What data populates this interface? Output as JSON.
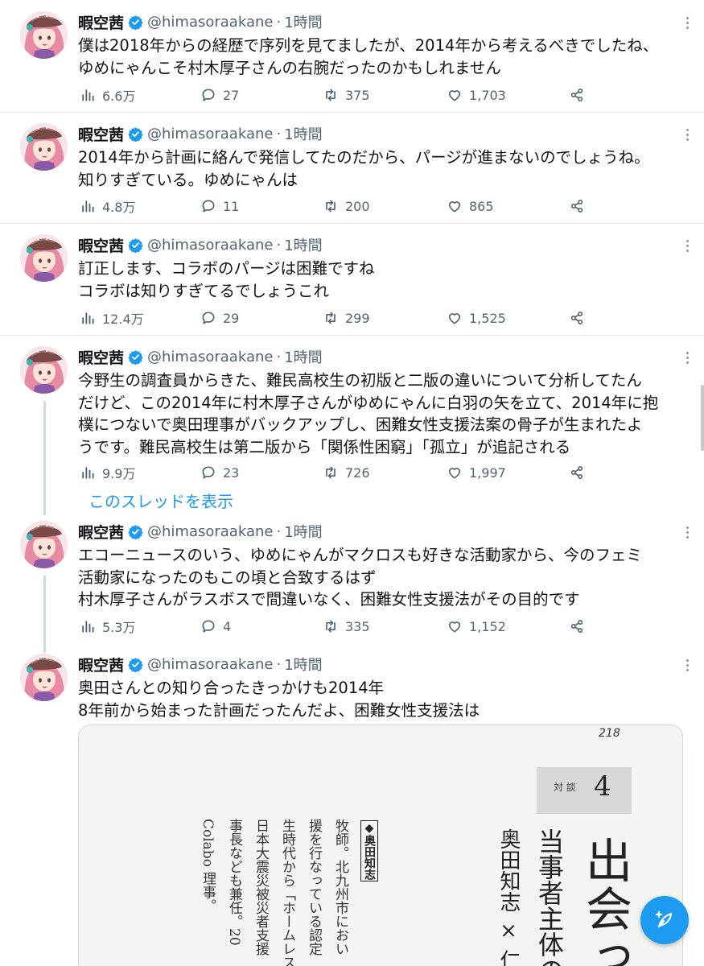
{
  "colors": {
    "accent": "#1d9bf0",
    "text": "#0f1419",
    "muted": "#536471",
    "verified": "#1d9bf0"
  },
  "tweets": [
    {
      "name": "暇空茜",
      "handle": "@himasoraakane",
      "time": "1時間",
      "lines": [
        "僕は2018年からの経歴で序列を見てましたが、2014年から考えるべきでしたね、",
        "ゆめにゃんこそ村木厚子さんの右腕だったのかもしれません"
      ],
      "views": "6.6万",
      "replies": "27",
      "retweets": "375",
      "likes": "1,703"
    },
    {
      "name": "暇空茜",
      "handle": "@himasoraakane",
      "time": "1時間",
      "lines": [
        "2014年から計画に絡んで発信してたのだから、パージが進まないのでしょうね。",
        "知りすぎている。ゆめにゃんは"
      ],
      "views": "4.8万",
      "replies": "11",
      "retweets": "200",
      "likes": "865"
    },
    {
      "name": "暇空茜",
      "handle": "@himasoraakane",
      "time": "1時間",
      "lines": [
        "訂正します、コラボのパージは困難ですね",
        "コラボは知りすぎてるでしょうこれ"
      ],
      "views": "12.4万",
      "replies": "29",
      "retweets": "299",
      "likes": "1,525"
    },
    {
      "name": "暇空茜",
      "handle": "@himasoraakane",
      "time": "1時間",
      "lines": [
        "今野生の調査員からきた、難民高校生の初版と二版の違いについて分析してたん",
        "だけど、この2014年に村木厚子さんがゆめにゃんに白羽の矢を立て、2014年に抱",
        "樸につないで奥田理事がバックアップし、困難女性支援法案の骨子が生まれたよ",
        "うです。難民高校生は第二版から「関係性困窮」「孤立」が追記される"
      ],
      "views": "9.9万",
      "replies": "23",
      "retweets": "726",
      "likes": "1,997",
      "show_thread": "このスレッドを表示"
    },
    {
      "name": "暇空茜",
      "handle": "@himasoraakane",
      "time": "1時間",
      "lines": [
        "エコーニュースのいう、ゆめにゃんがマクロスも好きな活動家から、今のフェミ",
        "活動家になったのもこの頃と合致するはず",
        "村木厚子さんがラスボスで間違いなく、困難女性支援法がその目的です"
      ],
      "views": "5.3万",
      "replies": "4",
      "retweets": "335",
      "likes": "1,152"
    },
    {
      "name": "暇空茜",
      "handle": "@himasoraakane",
      "time": "1時間",
      "lines": [
        "奥田さんとの知り合ったきっかけも2014年",
        "8年前から始まった計画だったんだよ、困難女性支援法は"
      ]
    }
  ],
  "media": {
    "page_number": "218",
    "box_label": "対 談",
    "box_number": "4",
    "title": "出会っ",
    "subtitle": "当事者主体の",
    "authors": "奥田知志 × 仁藤",
    "profile_heading": "◆奥田知志",
    "profile_lines": [
      "牧師。北九州市におい",
      "援を行なっている認定",
      "生時代から「ホームレス",
      "日本大震災被災者支援",
      "事長なども兼任。20",
      "Colabo 理事。"
    ]
  },
  "icons": {
    "views": "bar-chart-icon",
    "reply": "reply-icon",
    "retweet": "retweet-icon",
    "like": "heart-icon",
    "share": "share-icon",
    "verified": "verified-badge-icon",
    "more": "more-icon",
    "compose": "compose-icon"
  }
}
